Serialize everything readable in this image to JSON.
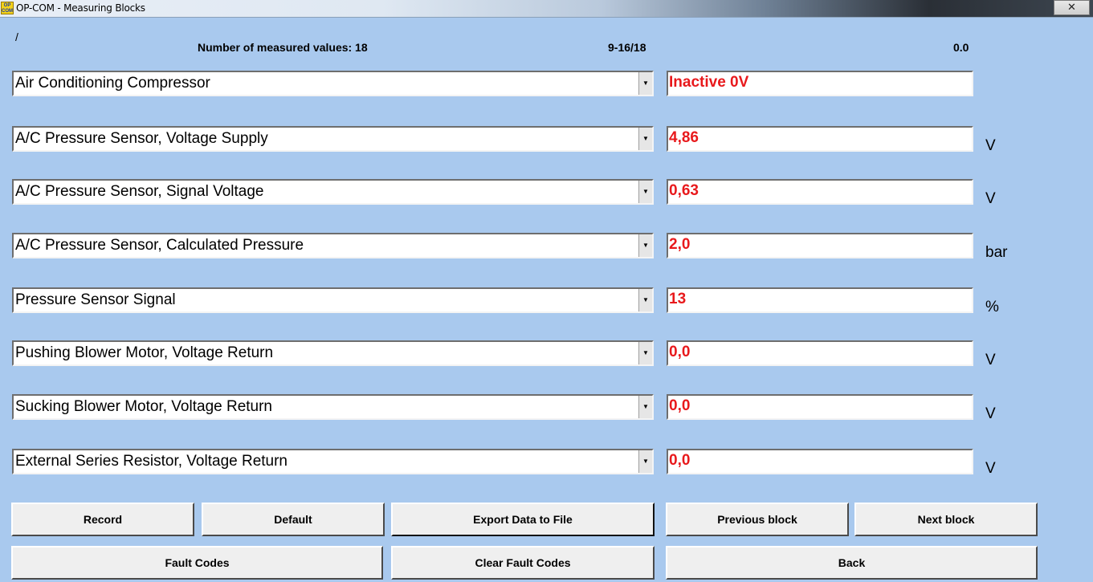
{
  "window": {
    "app_icon_text": "OP COM",
    "title": "OP-COM - Measuring Blocks",
    "close_glyph": "✕"
  },
  "header": {
    "marker": "/",
    "measured_count": "Number of measured values: 18",
    "range": "9-16/18",
    "timer": "0.0"
  },
  "rows": [
    {
      "name": "Air Conditioning Compressor",
      "value": "Inactive 0V",
      "unit": ""
    },
    {
      "name": "A/C Pressure Sensor, Voltage Supply",
      "value": "4,86",
      "unit": "V"
    },
    {
      "name": "A/C Pressure Sensor, Signal Voltage",
      "value": "0,63",
      "unit": "V"
    },
    {
      "name": "A/C Pressure Sensor, Calculated Pressure",
      "value": "2,0",
      "unit": "bar"
    },
    {
      "name": "Pressure Sensor Signal",
      "value": "13",
      "unit": "%"
    },
    {
      "name": "Pushing Blower Motor, Voltage Return",
      "value": "0,0",
      "unit": "V"
    },
    {
      "name": "Sucking Blower Motor, Voltage Return",
      "value": "0,0",
      "unit": "V"
    },
    {
      "name": "External Series Resistor, Voltage Return",
      "value": "0,0",
      "unit": "V"
    }
  ],
  "dropdown_arrow_glyph": "▼",
  "buttons": {
    "record": "Record",
    "default": "Default",
    "export": "Export Data to File",
    "previous": "Previous block",
    "next": "Next block",
    "fault_codes": "Fault Codes",
    "clear_fault_codes": "Clear Fault Codes",
    "back": "Back"
  },
  "colors": {
    "background": "#a9c9ee",
    "value_text": "#e8191c"
  }
}
